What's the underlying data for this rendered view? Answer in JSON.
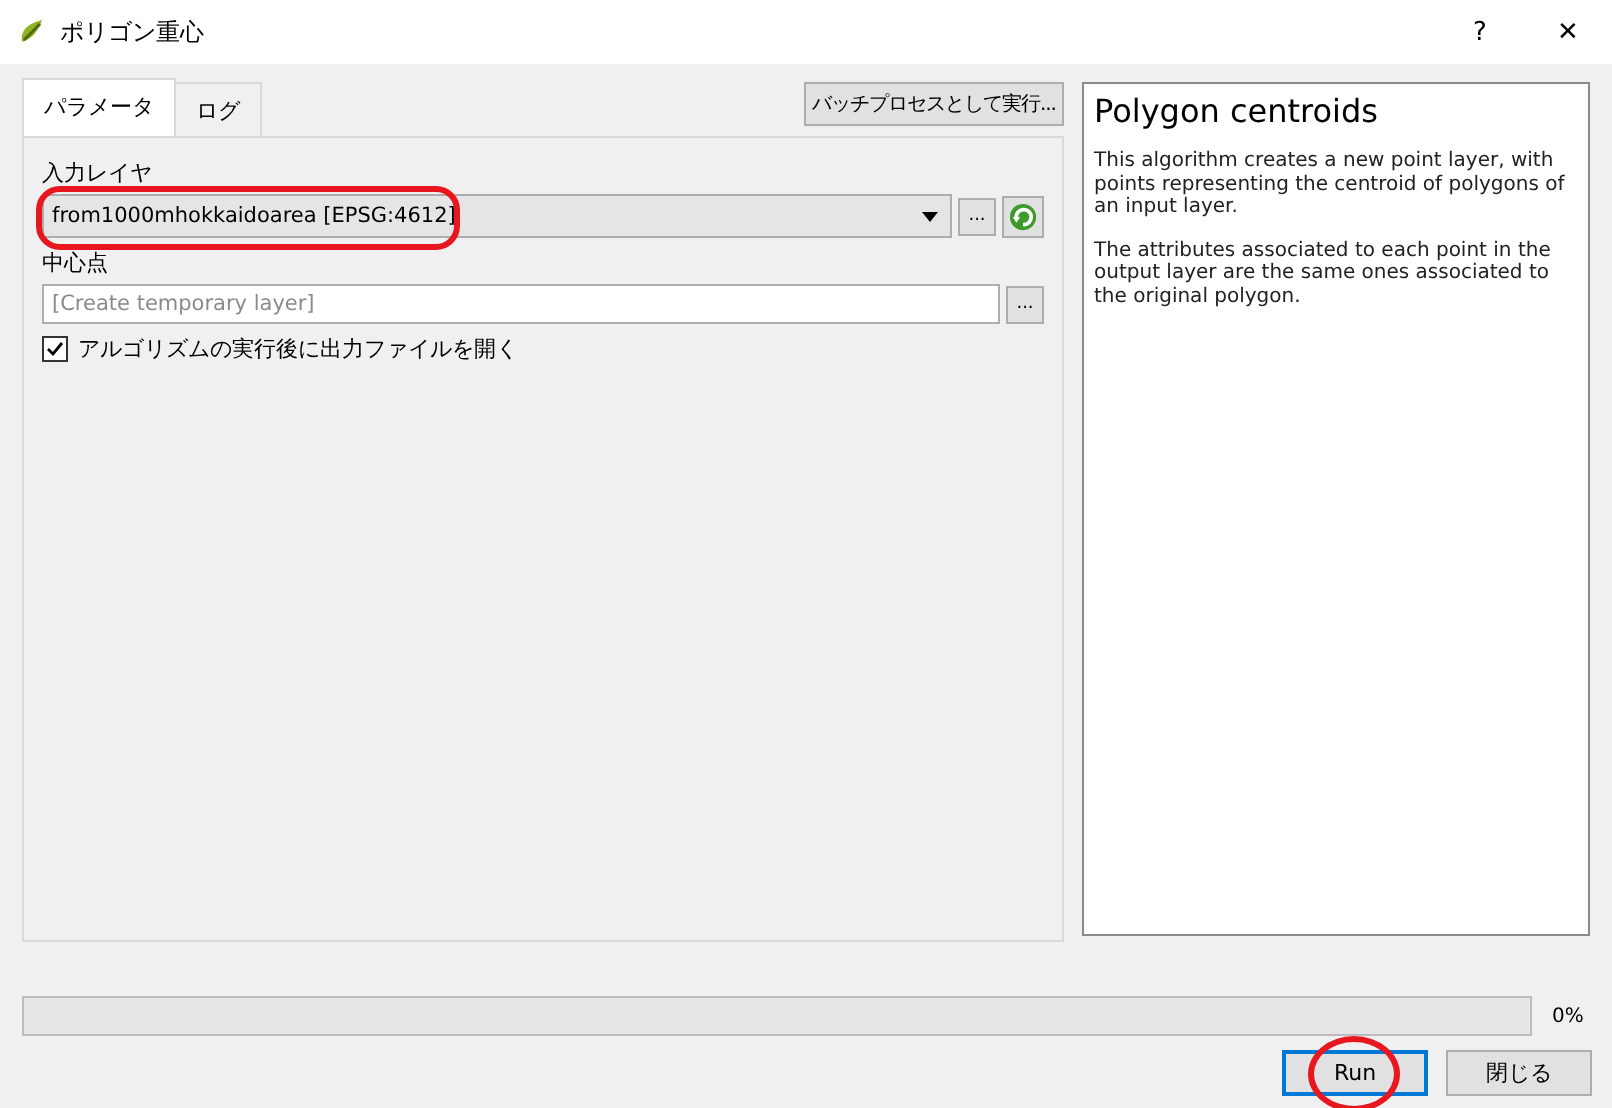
{
  "window": {
    "title": "ポリゴン重心",
    "help_button": "?",
    "close_button": "✕"
  },
  "tabs": [
    {
      "label": "パラメータ",
      "selected": true
    },
    {
      "label": "ログ",
      "selected": false
    }
  ],
  "batch_button": "バッチプロセスとして実行...",
  "parameters": {
    "input_layer": {
      "label": "入力レイヤ",
      "value": "from1000mhokkaidoarea [EPSG:4612]",
      "browse": "...",
      "highlighted": true
    },
    "output": {
      "label": "中心点",
      "placeholder": "[Create temporary layer]",
      "browse": "..."
    },
    "open_after": {
      "label": "アルゴリズムの実行後に出力ファイルを開く",
      "checked": true
    }
  },
  "help": {
    "title": "Polygon centroids",
    "paragraphs": [
      "This algorithm creates a new point layer, with points representing the centroid of polygons of an input layer.",
      "The attributes associated to each point in the output layer are the same ones associated to the original polygon."
    ]
  },
  "progress": {
    "level": 0,
    "reading": "0%"
  },
  "buttons": [
    {
      "label": "Run",
      "highlighted": true,
      "default": true
    },
    {
      "label": "閉じる",
      "highlighted": false,
      "default": false
    }
  ]
}
